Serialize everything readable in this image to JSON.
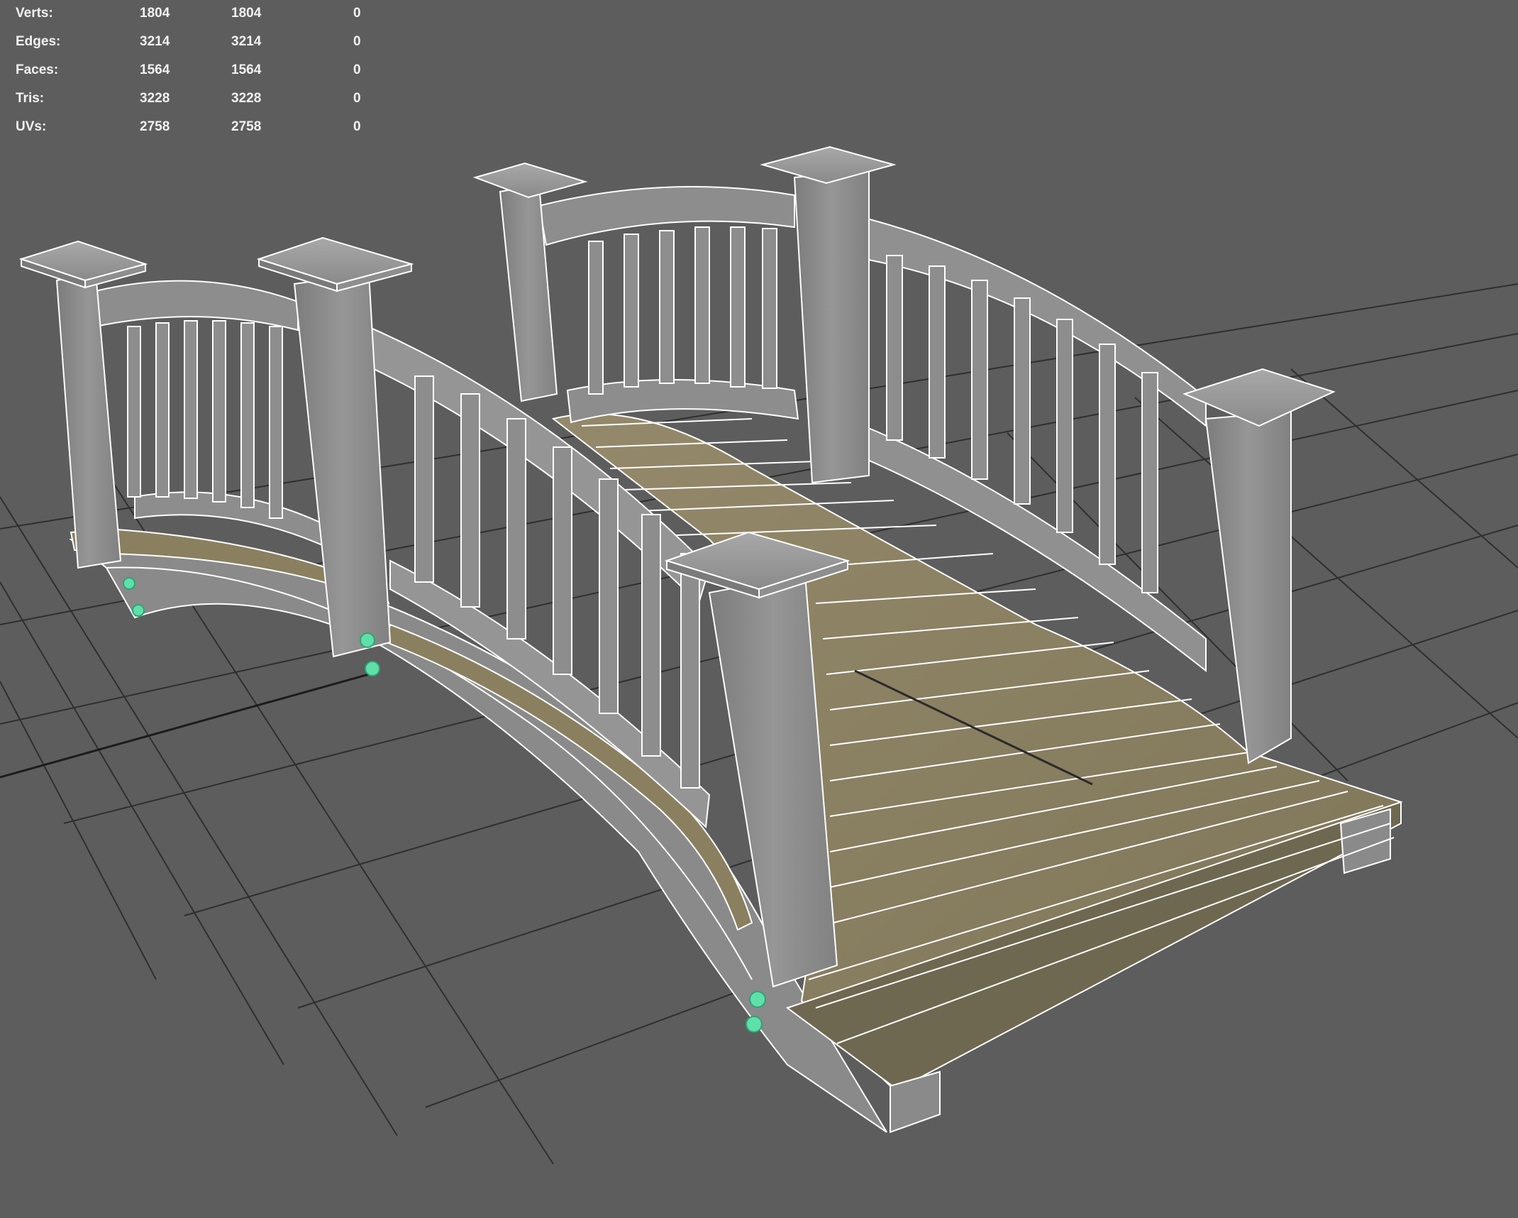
{
  "heads_up_display": {
    "poly_count": [
      {
        "label": "Verts:",
        "values": [
          "1804",
          "1804",
          "0"
        ]
      },
      {
        "label": "Edges:",
        "values": [
          "3214",
          "3214",
          "0"
        ]
      },
      {
        "label": "Faces:",
        "values": [
          "1564",
          "1564",
          "0"
        ]
      },
      {
        "label": "Tris:",
        "values": [
          "3228",
          "3228",
          "0"
        ]
      },
      {
        "label": "UVs:",
        "values": [
          "2758",
          "2758",
          "0"
        ]
      }
    ]
  },
  "viewport": {
    "background_color": "#5d5d5d",
    "grid_color": "#2f2f2f",
    "wire_color": "#ffffff",
    "railing_color": "#8e8e8e",
    "deck_color": "#8a8060",
    "selected_vertex_color": "#5fe0a8"
  }
}
